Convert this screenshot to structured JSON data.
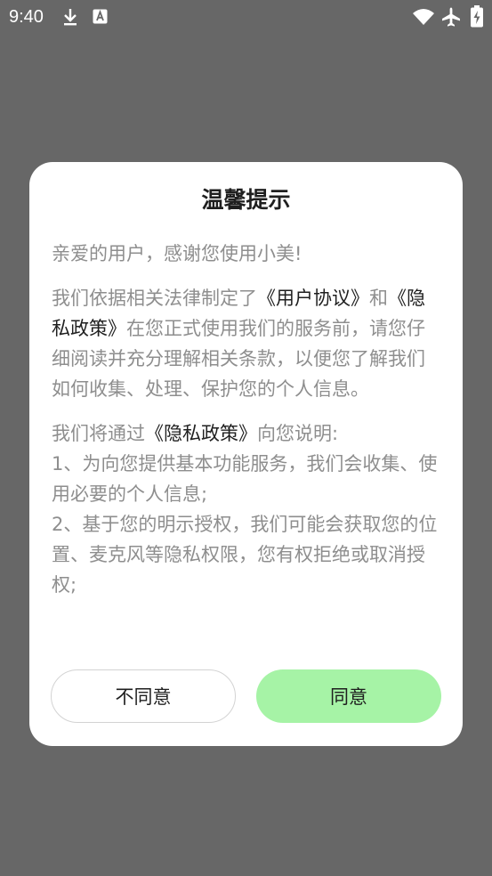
{
  "status_bar": {
    "time": "9:40",
    "icons": [
      "download-icon",
      "app-a-icon",
      "wifi-icon",
      "airplane-icon",
      "battery-charging-icon"
    ]
  },
  "dialog": {
    "title": "温馨提示",
    "greeting": "亲爱的用户，感谢您使用小美!",
    "paragraph1": {
      "prefix": "我们依据相关法律制定了",
      "link1": "《用户协议》",
      "middle": "和",
      "link2": "《隐私政策》",
      "suffix": "在您正式使用我们的服务前，请您仔细阅读并充分理解相关条款，以便您了解我们如何收集、处理、保护您的个人信息。"
    },
    "paragraph2": {
      "prefix": "我们将通过",
      "link": "《隐私政策》",
      "suffix": "向您说明:",
      "item1": "1、为向您提供基本功能服务，我们会收集、使用必要的个人信息;",
      "item2": "2、基于您的明示授权，我们可能会获取您的位置、麦克风等隐私权限，您有权拒绝或取消授权;"
    },
    "buttons": {
      "disagree": "不同意",
      "agree": "同意"
    }
  },
  "colors": {
    "overlay": "#676767",
    "accent_button": "#a6f3a6",
    "body_text": "#8e8e8e",
    "link_text": "#1f1f1f"
  }
}
